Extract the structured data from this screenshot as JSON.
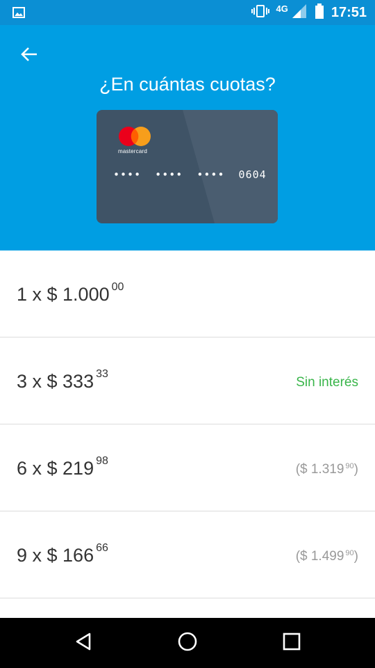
{
  "status_bar": {
    "network": "4G",
    "time": "17:51",
    "icons": [
      "image-icon",
      "vibrate-icon",
      "signal-icon",
      "battery-icon"
    ]
  },
  "header": {
    "title": "¿En cuántas cuotas?",
    "back_icon": "arrow-back-icon",
    "background_color": "#009ee3"
  },
  "card": {
    "brand": "mastercard",
    "masked_number": "••••  ••••  ••••  0604",
    "color": "#3f5366"
  },
  "installments": [
    {
      "count": "1",
      "amount": "1.000",
      "cents": "00",
      "label": "1 x $ 1.000",
      "note": "",
      "note_amount": "",
      "note_cents": ""
    },
    {
      "count": "3",
      "amount": "333",
      "cents": "33",
      "label": "3 x $ 333",
      "note": "Sin interés",
      "note_amount": "",
      "note_cents": ""
    },
    {
      "count": "6",
      "amount": "219",
      "cents": "98",
      "label": "6 x $ 219",
      "note": "",
      "note_amount": "($ 1.319",
      "note_cents": "90"
    },
    {
      "count": "9",
      "amount": "166",
      "cents": "66",
      "label": "9 x $ 166",
      "note": "",
      "note_amount": "($ 1.499",
      "note_cents": "90"
    }
  ],
  "colors": {
    "accent_green": "#39b54a",
    "muted_text": "#999999"
  }
}
